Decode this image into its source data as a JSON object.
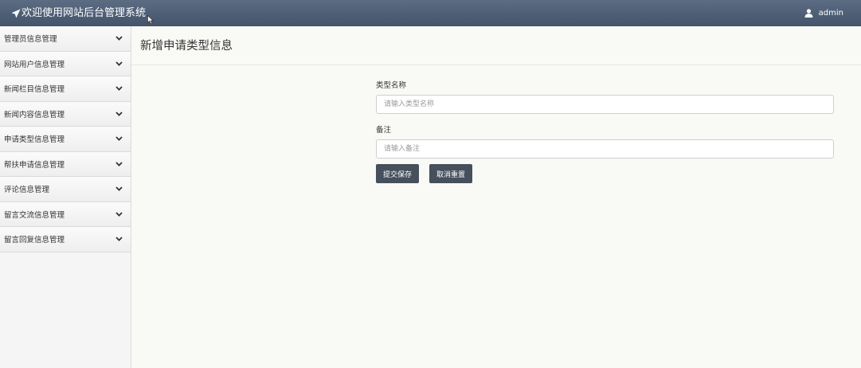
{
  "header": {
    "brand_icon": "send-icon",
    "title": "欢迎使用网站后台管理系统",
    "user_icon": "user-icon",
    "username": "admin"
  },
  "sidebar": {
    "items": [
      {
        "label": "管理员信息管理",
        "icon": "chevron-down-icon"
      },
      {
        "label": "网站用户信息管理",
        "icon": "chevron-down-icon"
      },
      {
        "label": "新闻栏目信息管理",
        "icon": "chevron-down-icon"
      },
      {
        "label": "新闻内容信息管理",
        "icon": "chevron-down-icon"
      },
      {
        "label": "申请类型信息管理",
        "icon": "chevron-down-icon"
      },
      {
        "label": "帮扶申请信息管理",
        "icon": "chevron-down-icon"
      },
      {
        "label": "评论信息管理",
        "icon": "chevron-down-icon"
      },
      {
        "label": "留言交流信息管理",
        "icon": "chevron-down-icon"
      },
      {
        "label": "留言回复信息管理",
        "icon": "chevron-down-icon"
      }
    ]
  },
  "main": {
    "title": "新增申请类型信息",
    "form": {
      "type_name_label": "类型名称",
      "type_name_placeholder": "请输入类型名称",
      "type_name_value": "",
      "remark_label": "备注",
      "remark_placeholder": "请输入备注",
      "remark_value": "",
      "submit_label": "提交保存",
      "reset_label": "取消重置"
    }
  },
  "colors": {
    "topbar": "#4e5e75",
    "button": "#46505c",
    "background": "#f9f9f6"
  }
}
